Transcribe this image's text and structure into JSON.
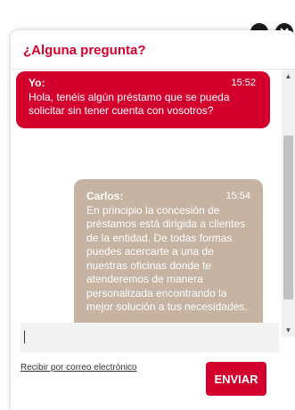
{
  "window_controls": {
    "minimize_icon": "minimize-icon",
    "close_icon": "close-icon"
  },
  "chat": {
    "title": "¿Alguna pregunta?",
    "messages": [
      {
        "sender": "Yo:",
        "time": "15:52",
        "text": "Hola, tenéis algún préstamo que se pueda solicitar sin tener cuenta con vosotros?"
      },
      {
        "sender": "Carlos:",
        "time": "15:54",
        "text": "En principio la concesión de préstamos está dirigida a clientes de la entidad. De todas formas puedes acercarte a una de nuestras oficinas donde te atenderemos de manera personalizada encontrando la mejor solución a tus necesidades."
      }
    ],
    "input": {
      "value": "",
      "placeholder": ""
    },
    "email_link": "Recibir por correo electrónico",
    "send_label": "ENVIAR"
  },
  "colors": {
    "brand": "#d3002e",
    "agent_bubble": "#c6b3a2",
    "input_bg": "#f3f3f3"
  }
}
